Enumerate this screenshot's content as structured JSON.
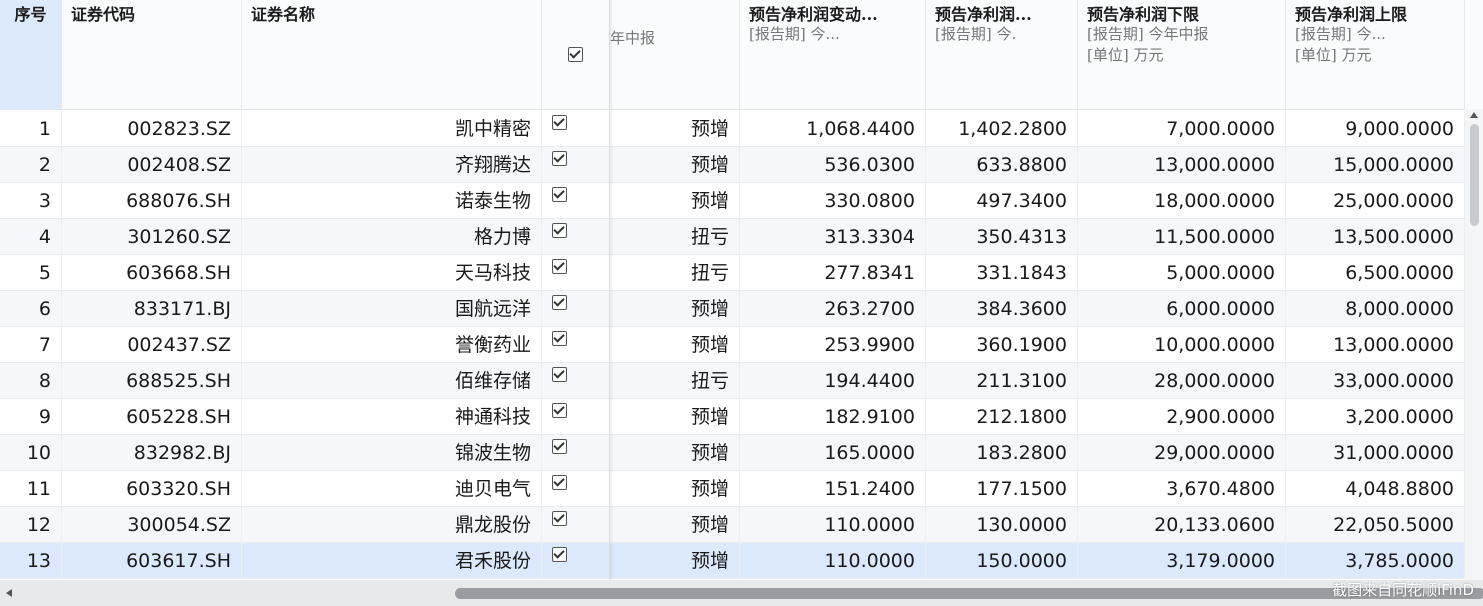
{
  "headers": {
    "seq": "序号",
    "code": "证券代码",
    "name": "证券名称",
    "partial_col_sub": "年中报",
    "change": {
      "title": "预告净利润变动...",
      "sub1": "[报告期]  今..."
    },
    "profit": {
      "title": "预告净利润...",
      "sub1": "[报告期]  今."
    },
    "lower": {
      "title": "预告净利润下限",
      "sub1": "[报告期]  今年中报",
      "sub2": "[单位]  万元"
    },
    "upper": {
      "title": "预告净利润上限",
      "sub1": "[报告期]  今...",
      "sub2": "[单位]  万元"
    }
  },
  "rows": [
    {
      "seq": "1",
      "code": "002823.SZ",
      "name": "凯中精密",
      "type": "预增",
      "change": "1,068.4400",
      "profit": "1,402.2800",
      "lower": "7,000.0000",
      "upper": "9,000.0000"
    },
    {
      "seq": "2",
      "code": "002408.SZ",
      "name": "齐翔腾达",
      "type": "预增",
      "change": "536.0300",
      "profit": "633.8800",
      "lower": "13,000.0000",
      "upper": "15,000.0000"
    },
    {
      "seq": "3",
      "code": "688076.SH",
      "name": "诺泰生物",
      "type": "预增",
      "change": "330.0800",
      "profit": "497.3400",
      "lower": "18,000.0000",
      "upper": "25,000.0000"
    },
    {
      "seq": "4",
      "code": "301260.SZ",
      "name": "格力博",
      "type": "扭亏",
      "change": "313.3304",
      "profit": "350.4313",
      "lower": "11,500.0000",
      "upper": "13,500.0000"
    },
    {
      "seq": "5",
      "code": "603668.SH",
      "name": "天马科技",
      "type": "扭亏",
      "change": "277.8341",
      "profit": "331.1843",
      "lower": "5,000.0000",
      "upper": "6,500.0000"
    },
    {
      "seq": "6",
      "code": "833171.BJ",
      "name": "国航远洋",
      "type": "预增",
      "change": "263.2700",
      "profit": "384.3600",
      "lower": "6,000.0000",
      "upper": "8,000.0000"
    },
    {
      "seq": "7",
      "code": "002437.SZ",
      "name": "誉衡药业",
      "type": "预增",
      "change": "253.9900",
      "profit": "360.1900",
      "lower": "10,000.0000",
      "upper": "13,000.0000"
    },
    {
      "seq": "8",
      "code": "688525.SH",
      "name": "佰维存储",
      "type": "扭亏",
      "change": "194.4400",
      "profit": "211.3100",
      "lower": "28,000.0000",
      "upper": "33,000.0000"
    },
    {
      "seq": "9",
      "code": "605228.SH",
      "name": "神通科技",
      "type": "预增",
      "change": "182.9100",
      "profit": "212.1800",
      "lower": "2,900.0000",
      "upper": "3,200.0000"
    },
    {
      "seq": "10",
      "code": "832982.BJ",
      "name": "锦波生物",
      "type": "预增",
      "change": "165.0000",
      "profit": "183.2800",
      "lower": "29,000.0000",
      "upper": "31,000.0000"
    },
    {
      "seq": "11",
      "code": "603320.SH",
      "name": "迪贝电气",
      "type": "预增",
      "change": "151.2400",
      "profit": "177.1500",
      "lower": "3,670.4800",
      "upper": "4,048.8800"
    },
    {
      "seq": "12",
      "code": "300054.SZ",
      "name": "鼎龙股份",
      "type": "预增",
      "change": "110.0000",
      "profit": "130.0000",
      "lower": "20,133.0600",
      "upper": "22,050.5000"
    },
    {
      "seq": "13",
      "code": "603617.SH",
      "name": "君禾股份",
      "type": "预增",
      "change": "110.0000",
      "profit": "150.0000",
      "lower": "3,179.0000",
      "upper": "3,785.0000"
    }
  ],
  "selected_row": "13",
  "watermark": "截图来自同花顺iFinD",
  "icons": {
    "checkbox": "checkbox-checked-icon",
    "scroll_up": "scroll-up-arrow-icon",
    "scroll_left": "scroll-left-arrow-icon"
  }
}
